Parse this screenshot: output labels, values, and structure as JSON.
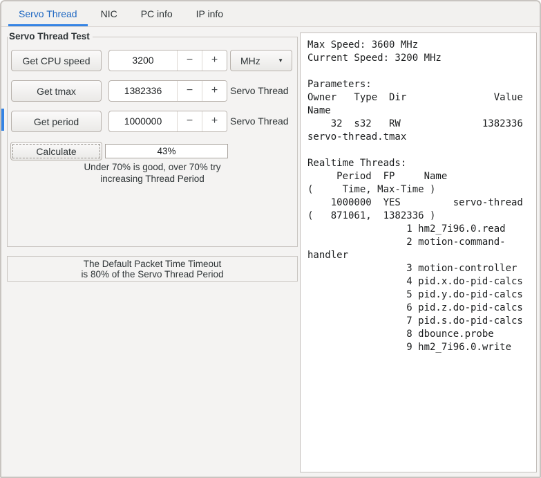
{
  "tabs": [
    {
      "label": "Servo Thread"
    },
    {
      "label": "NIC"
    },
    {
      "label": "PC info"
    },
    {
      "label": "IP info"
    }
  ],
  "frame": {
    "title": "Servo Thread Test",
    "cpu_row": {
      "button": "Get CPU speed",
      "value": "3200",
      "unit": "MHz"
    },
    "tmax_row": {
      "button": "Get tmax",
      "value": "1382336",
      "label": "Servo Thread"
    },
    "period_row": {
      "button": "Get period",
      "value": "1000000",
      "label": "Servo Thread"
    },
    "calc_row": {
      "button": "Calculate",
      "result": "43%"
    },
    "hint": {
      "line1": "Under 70% is good, over 70% try",
      "line2": "increasing Thread Period"
    }
  },
  "spinner": {
    "decrement": "−",
    "increment": "+"
  },
  "unit_dropdown": {
    "arrow": "▼"
  },
  "note": {
    "line1": "The Default Packet Time Timeout",
    "line2": "is 80% of the Servo Thread Period"
  },
  "output_lines": [
    "Max Speed: 3600 MHz",
    "Current Speed: 3200 MHz",
    "",
    "Parameters:",
    "Owner   Type  Dir               Value",
    "Name",
    "    32  s32   RW              1382336",
    "servo-thread.tmax",
    "",
    "Realtime Threads:",
    "     Period  FP     Name",
    "(     Time, Max-Time )",
    "    1000000  YES         servo-thread",
    "(   871061,  1382336 )",
    "                 1 hm2_7i96.0.read",
    "                 2 motion-command-",
    "handler",
    "                 3 motion-controller",
    "                 4 pid.x.do-pid-calcs",
    "                 5 pid.y.do-pid-calcs",
    "                 6 pid.z.do-pid-calcs",
    "                 7 pid.s.do-pid-calcs",
    "                 8 dbounce.probe",
    "                 9 hm2_7i96.0.write"
  ],
  "colors": {
    "accent": "#3584e4",
    "active_tab_text": "#1c66c2"
  }
}
